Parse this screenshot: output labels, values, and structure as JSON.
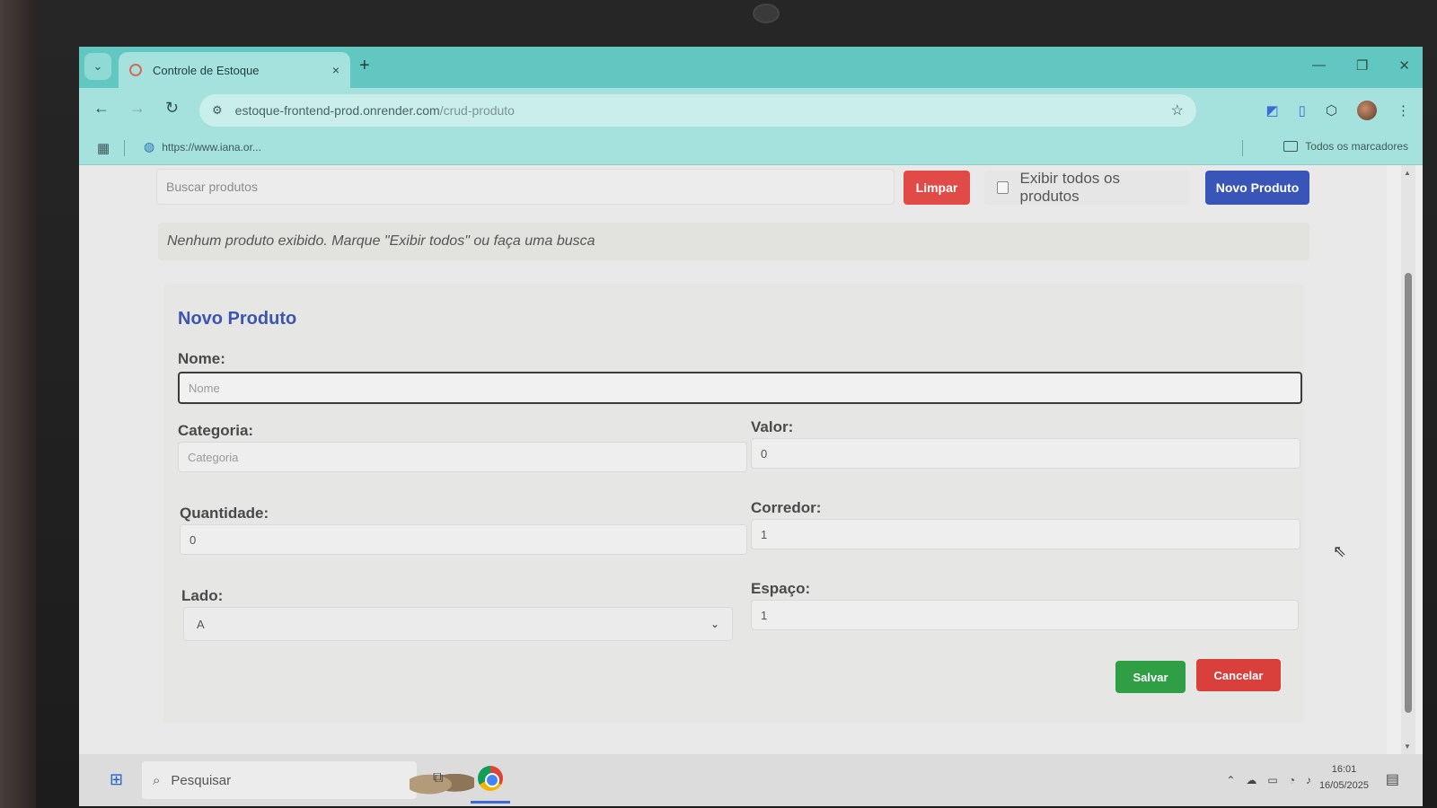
{
  "browser": {
    "tab_title": "Controle de Estoque",
    "tab_close": "×",
    "new_tab": "+",
    "url_host": "estoque-frontend-prod.onrender.com",
    "url_path": "/crud-produto",
    "bookmark_item": "https://www.iana.or...",
    "all_bookmarks": "Todos os marcadores"
  },
  "toolbar": {
    "search_placeholder": "Buscar produtos",
    "clear_label": "Limpar",
    "show_all_label": "Exibir todos os produtos",
    "new_product_label": "Novo Produto"
  },
  "info_message": "Nenhum produto exibido. Marque \"Exibir todos\" ou faça uma busca",
  "form": {
    "title": "Novo Produto",
    "name_label": "Nome:",
    "name_placeholder": "Nome",
    "category_label": "Categoria:",
    "category_placeholder": "Categoria",
    "value_label": "Valor:",
    "value_value": "0",
    "quantity_label": "Quantidade:",
    "quantity_value": "0",
    "corridor_label": "Corredor:",
    "corridor_value": "1",
    "side_label": "Lado:",
    "side_value": "A",
    "space_label": "Espaço:",
    "space_value": "1",
    "save_label": "Salvar",
    "cancel_label": "Cancelar"
  },
  "taskbar": {
    "search_label": "Pesquisar",
    "time": "16:01",
    "date": "16/05/2025"
  },
  "colors": {
    "accent_blue": "#3a55b8",
    "danger_red": "#e04a47",
    "success_green": "#2f9e45",
    "browser_teal": "#62c7c0"
  }
}
